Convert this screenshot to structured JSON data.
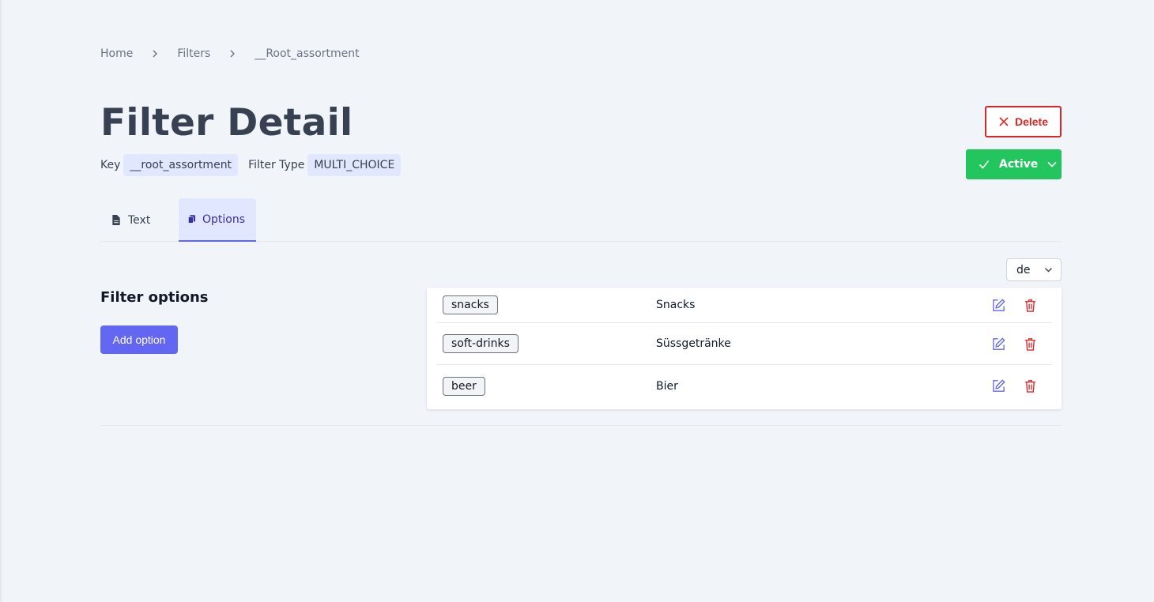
{
  "breadcrumb": {
    "items": [
      "Home",
      "Filters",
      "__Root_assortment"
    ]
  },
  "header": {
    "title": "Filter Detail",
    "key_label": "Key",
    "key_value": "__root_assortment",
    "type_label": "Filter Type",
    "type_value": "MULTI_CHOICE"
  },
  "actions": {
    "delete_label": "Delete",
    "active_label": "Active"
  },
  "tabs": [
    {
      "label": "Text",
      "icon": "document-icon"
    },
    {
      "label": "Options",
      "icon": "clipboard-icon"
    }
  ],
  "section": {
    "title": "Filter options",
    "add_label": "Add option"
  },
  "language": {
    "selected": "de"
  },
  "options": [
    {
      "key": "snacks",
      "label": "Snacks"
    },
    {
      "key": "soft-drinks",
      "label": "Süssgetränke"
    },
    {
      "key": "beer",
      "label": "Bier"
    }
  ],
  "colors": {
    "accent": "#6366f1",
    "success": "#22c55e",
    "danger": "#dc2626"
  }
}
